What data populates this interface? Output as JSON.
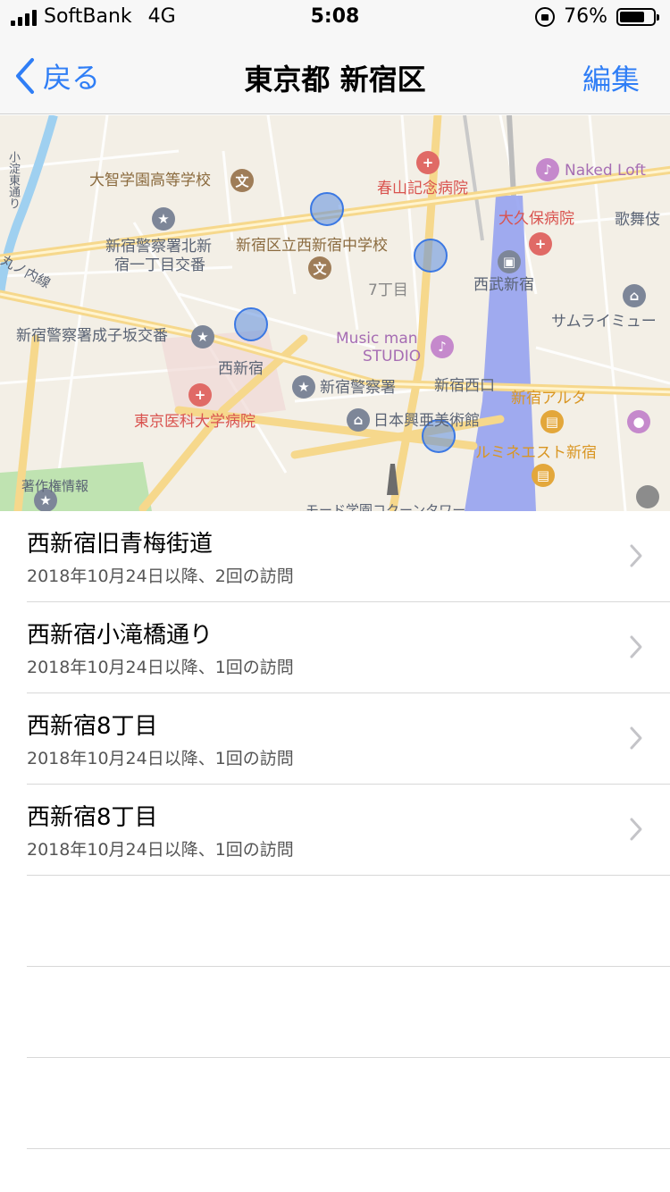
{
  "status_bar": {
    "carrier": "SoftBank",
    "network": "4G",
    "time": "5:08",
    "battery": "76%",
    "battery_level": 0.76
  },
  "nav": {
    "back_label": "戻る",
    "title": "東京都 新宿区",
    "edit_label": "編集"
  },
  "map": {
    "labels": {
      "school1": "大智学園高等学校",
      "hospital1": "春山記念病院",
      "loft": "Naked Loft",
      "hospital2": "大久保病院",
      "kabuki": "歌舞伎",
      "police1a": "新宿警察署北新",
      "police1b": "宿一丁目交番",
      "school2": "新宿区立西新宿中学校",
      "seibu": "西武新宿",
      "chome7": "7丁目",
      "samurai": "サムライミュー",
      "police2": "新宿警察署成子坂交番",
      "musicman": "Music man",
      "studio": "STUDIO",
      "nishishinjuku": "西新宿",
      "police3": "新宿警察署",
      "nishiguchi": "新宿西口",
      "alta": "新宿アルタ",
      "hospital3": "東京医科大学病院",
      "museum": "日本興亜美術館",
      "lumine": "ルミネエスト新宿",
      "copyright": "著作権情報",
      "mode": "モード学園コクーンタワー",
      "marunouchi": "丸ノ内線",
      "yodobashi": "小淀東通り"
    }
  },
  "visits": [
    {
      "title": "西新宿旧青梅街道",
      "subtitle": "2018年10月24日以降、2回の訪問"
    },
    {
      "title": "西新宿小滝橋通り",
      "subtitle": "2018年10月24日以降、1回の訪問"
    },
    {
      "title": "西新宿8丁目",
      "subtitle": "2018年10月24日以降、1回の訪問"
    },
    {
      "title": "西新宿8丁目",
      "subtitle": "2018年10月24日以降、1回の訪問"
    }
  ]
}
